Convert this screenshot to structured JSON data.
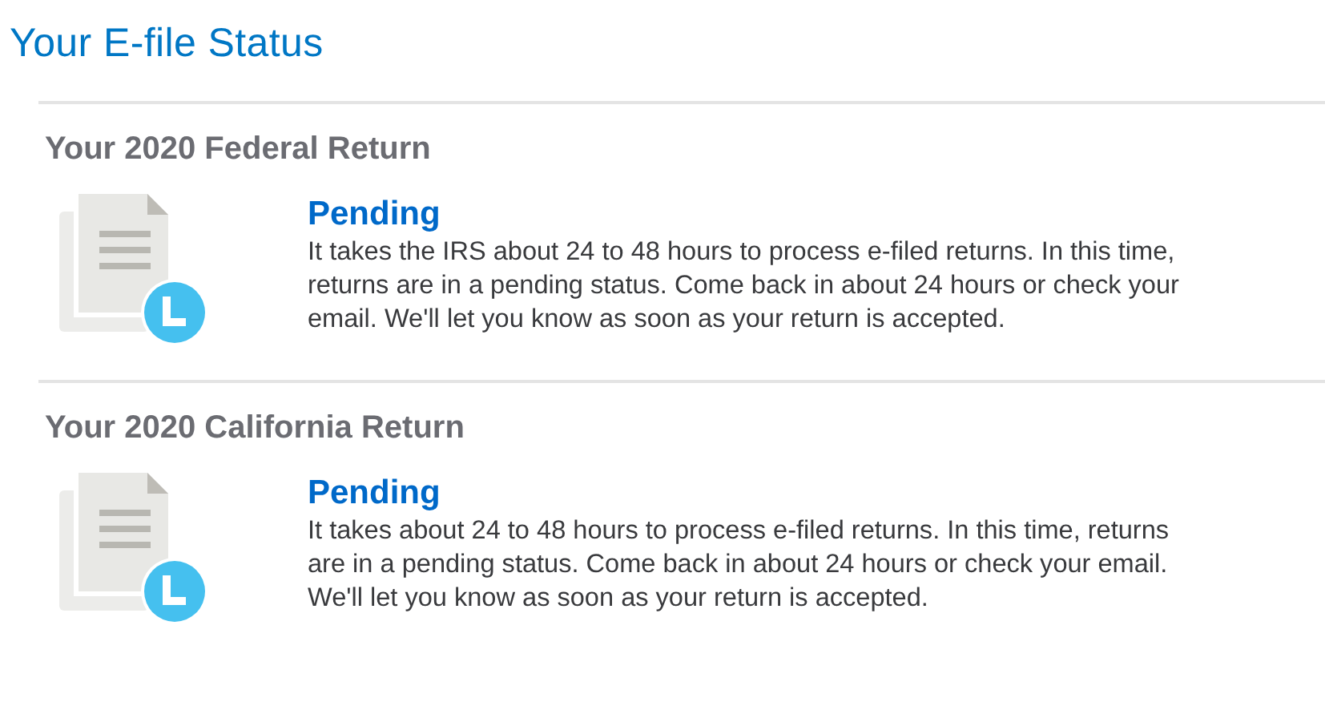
{
  "title": "Your E-file Status",
  "returns": [
    {
      "heading": "Your 2020 Federal Return",
      "status": "Pending",
      "message": "It takes the IRS about 24 to 48 hours to process e-filed returns. In this time, returns are in a pending status. Come back in about 24 hours or check your email. We'll let you know as soon as your return is accepted."
    },
    {
      "heading": "Your 2020 California Return",
      "status": "Pending",
      "message": "It takes about 24 to 48 hours to process e-filed returns. In this time, returns are in a pending status. Come back in about 24 hours or check your email. We'll let you know as soon as your return is accepted."
    }
  ]
}
